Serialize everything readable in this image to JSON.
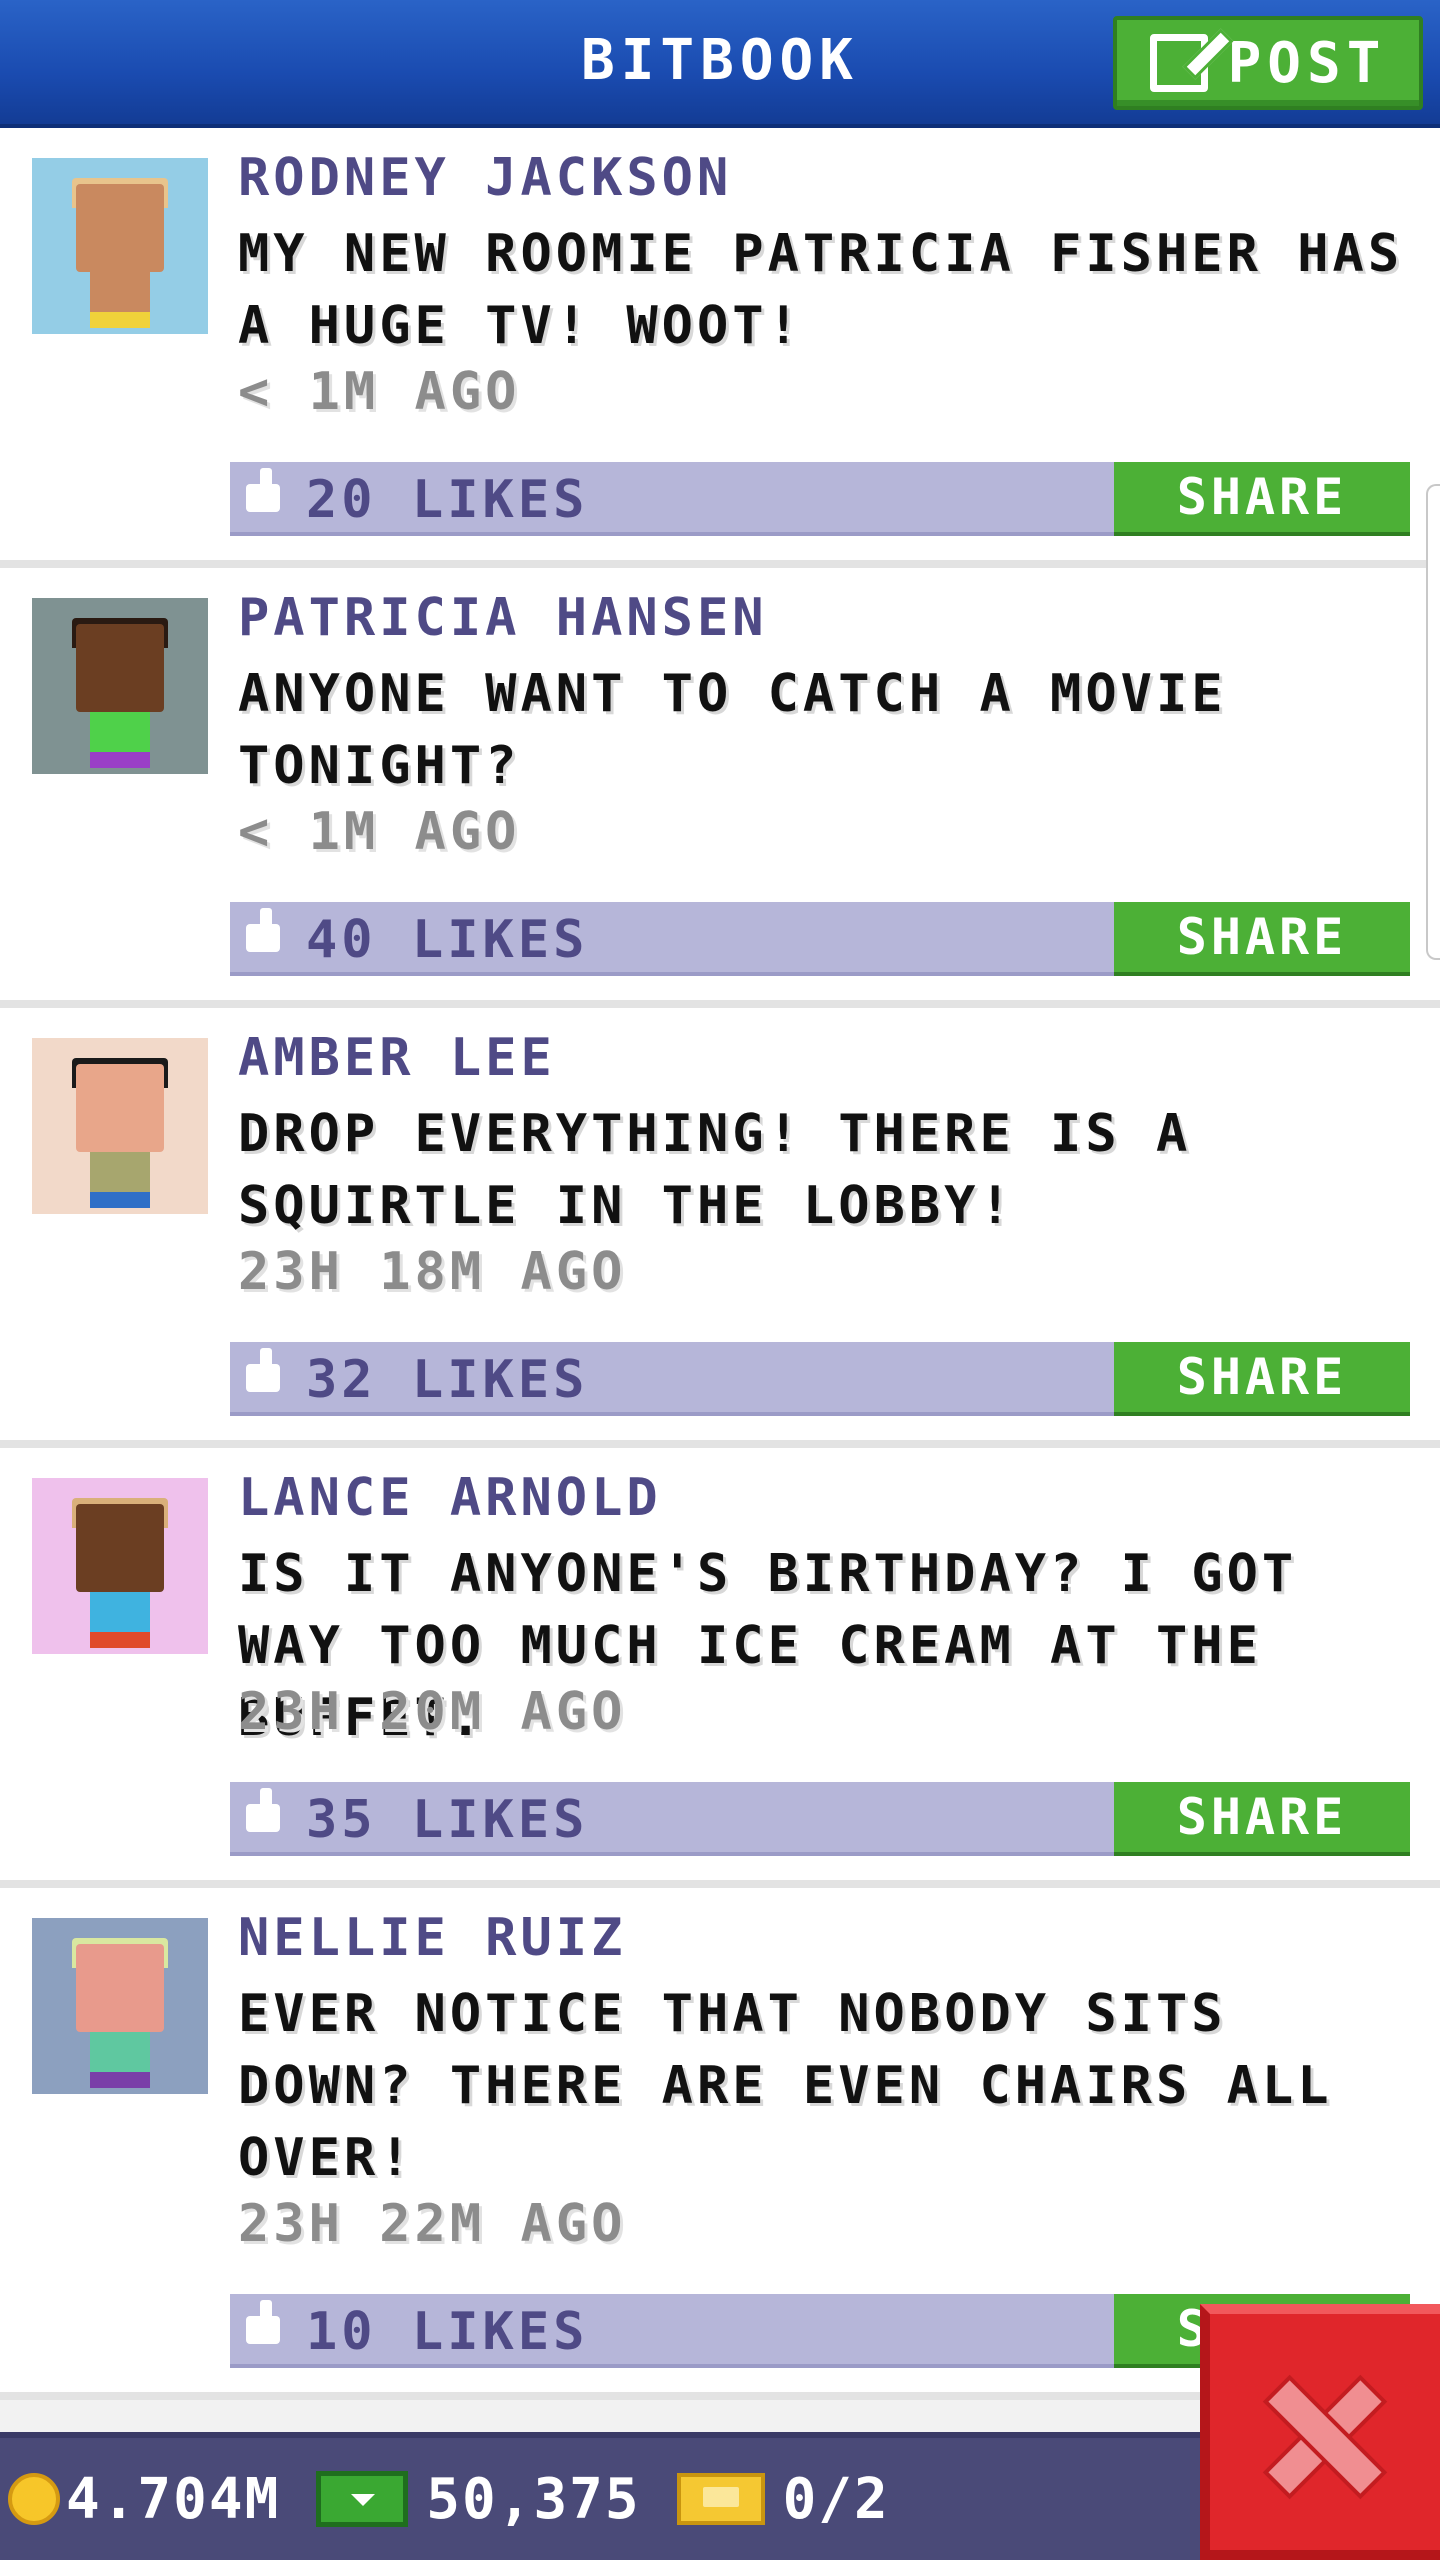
{
  "header": {
    "title": "BITBOOK",
    "post_label": "POST"
  },
  "colors": {
    "header_blue": "#1a4bb0",
    "name_purple": "#4f4a86",
    "likes_bar": "#b6b6d9",
    "share_green": "#4cb036",
    "close_red": "#e0262b"
  },
  "posts": [
    {
      "name": "RODNEY JACKSON",
      "message": "MY NEW ROOMIE PATRICIA FISHER HAS A HUGE TV! WOOT!",
      "time": "< 1M AGO",
      "likes": "20 LIKES",
      "share": "SHARE",
      "avatar_bg": "#94cde6",
      "skin": "#c9895f",
      "hair": "#e8c48c",
      "shirt": "#c9895f",
      "pants": "#f0d23a"
    },
    {
      "name": "PATRICIA HANSEN",
      "message": "ANYONE WANT TO CATCH A MOVIE TONIGHT?",
      "time": "< 1M AGO",
      "likes": "40 LIKES",
      "share": "SHARE",
      "avatar_bg": "#7f9292",
      "skin": "#6b3e22",
      "hair": "#2a1a12",
      "shirt": "#4fd14a",
      "pants": "#9a3fc7"
    },
    {
      "name": "AMBER LEE",
      "message": "DROP EVERYTHING! THERE IS A SQUIRTLE IN THE LOBBY!",
      "time": "23H 18M AGO",
      "likes": "32 LIKES",
      "share": "SHARE",
      "avatar_bg": "#f2d9c9",
      "skin": "#e8a68a",
      "hair": "#1a1a1a",
      "shirt": "#a7a66e",
      "pants": "#2f6fc7"
    },
    {
      "name": "LANCE ARNOLD",
      "message": "IS IT ANYONE'S BIRTHDAY? I GOT WAY TOO MUCH ICE CREAM AT THE BUFFET.",
      "time": "23H 20M AGO",
      "likes": "35 LIKES",
      "share": "SHARE",
      "avatar_bg": "#efc1ec",
      "skin": "#6b3e22",
      "hair": "#d9b07a",
      "shirt": "#3fb3e0",
      "pants": "#e04a2a"
    },
    {
      "name": "NELLIE RUIZ",
      "message": "EVER NOTICE THAT NOBODY SITS DOWN? THERE ARE EVEN CHAIRS ALL OVER!",
      "time": "23H 22M AGO",
      "likes": "10 LIKES",
      "share": "SHARE",
      "avatar_bg": "#8ca0bf",
      "skin": "#e89a8c",
      "hair": "#d9e8a0",
      "shirt": "#5fc8a0",
      "pants": "#7a3fa8"
    }
  ],
  "status": {
    "coins": "4.704M",
    "bux": "50,375",
    "tickets": "0/2"
  },
  "icons": [
    "post-edit-icon",
    "thumbs-up-icon",
    "coin-icon",
    "bux-icon",
    "ticket-icon",
    "close-icon"
  ]
}
